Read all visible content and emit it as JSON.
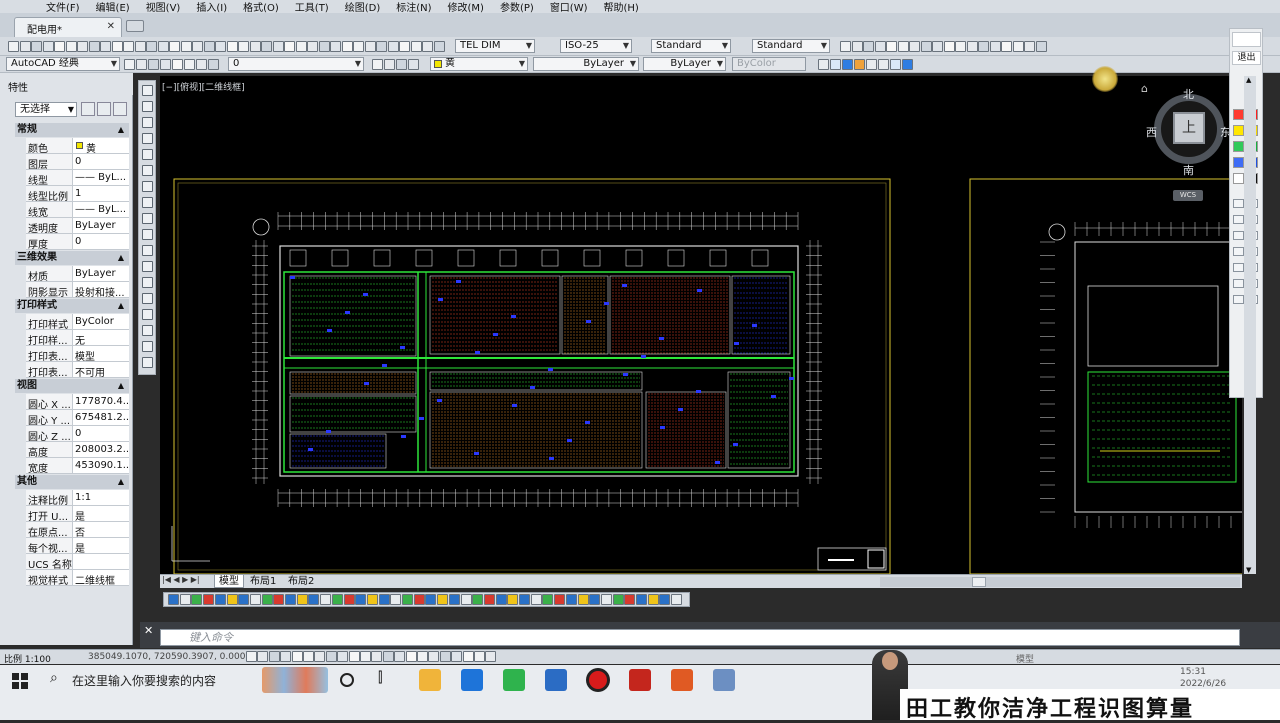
{
  "menu": [
    "文件(F)",
    "编辑(E)",
    "视图(V)",
    "插入(I)",
    "格式(O)",
    "工具(T)",
    "绘图(D)",
    "标注(N)",
    "修改(M)",
    "参数(P)",
    "窗口(W)",
    "帮助(H)"
  ],
  "document_tab": {
    "label": "配电用*",
    "close": "✕"
  },
  "toolbar1": {
    "text_style": "TEL DIM",
    "dim_style": "ISO-25",
    "table_style": "Standard",
    "mleader_style": "Standard"
  },
  "toolbar2": {
    "workspace": "AutoCAD 经典",
    "layer": "0",
    "color": "黄",
    "linetype": "ByLayer",
    "lineweight": "ByLayer",
    "plotstyle": "ByColor"
  },
  "properties": {
    "title": "特性",
    "selection": "无选择",
    "sections": [
      {
        "name": "常规",
        "rows": [
          [
            "颜色",
            "黄"
          ],
          [
            "图层",
            "0"
          ],
          [
            "线型",
            "—— ByL..."
          ],
          [
            "线型比例",
            "1"
          ],
          [
            "线宽",
            "—— ByL..."
          ],
          [
            "透明度",
            "ByLayer"
          ],
          [
            "厚度",
            "0"
          ]
        ]
      },
      {
        "name": "三维效果",
        "rows": [
          [
            "材质",
            "ByLayer"
          ],
          [
            "阴影显示",
            "投射和接..."
          ]
        ]
      },
      {
        "name": "打印样式",
        "rows": [
          [
            "打印样式",
            "ByColor"
          ],
          [
            "打印样...",
            "无"
          ],
          [
            "打印表...",
            "模型"
          ],
          [
            "打印表...",
            "不可用"
          ]
        ]
      },
      {
        "name": "视图",
        "rows": [
          [
            "圆心 X ...",
            "177870.4..."
          ],
          [
            "圆心 Y ...",
            "675481.2..."
          ],
          [
            "圆心 Z ...",
            "0"
          ],
          [
            "高度",
            "208003.2..."
          ],
          [
            "宽度",
            "453090.1..."
          ]
        ]
      },
      {
        "name": "其他",
        "rows": [
          [
            "注释比例",
            "1:1"
          ],
          [
            "打开 U...",
            "是"
          ],
          [
            "在原点...",
            "否"
          ],
          [
            "每个视...",
            "是"
          ],
          [
            "UCS 名称",
            ""
          ],
          [
            "视觉样式",
            "二维线框"
          ]
        ]
      }
    ]
  },
  "viewport_label": "[−][俯视][二维线框]",
  "viewcube": {
    "north": "北",
    "south": "南",
    "west": "西",
    "east": "东",
    "face": "上",
    "wcs": "WCS"
  },
  "right_palette": {
    "exit": "退出"
  },
  "layout_tabs": [
    "模型",
    "布局1",
    "布局2"
  ],
  "command_prompt": "键入命令",
  "status": {
    "scale": "比例 1:100",
    "coords": "385049.1070, 720590.3907, 0.0000",
    "model": "模型"
  },
  "taskbar": {
    "search_placeholder": "在这里输入你要搜索的内容",
    "time": "15:31",
    "date": "2022/6/26"
  },
  "banner": "田工教你洁净工程识图算量",
  "colors": {
    "canvas": "#000000",
    "border_yellow": "#d7c531",
    "line_green": "#2ee63a",
    "line_blue": "#2a38ff",
    "line_red": "#e8452b",
    "line_white": "#dcdcdc"
  }
}
